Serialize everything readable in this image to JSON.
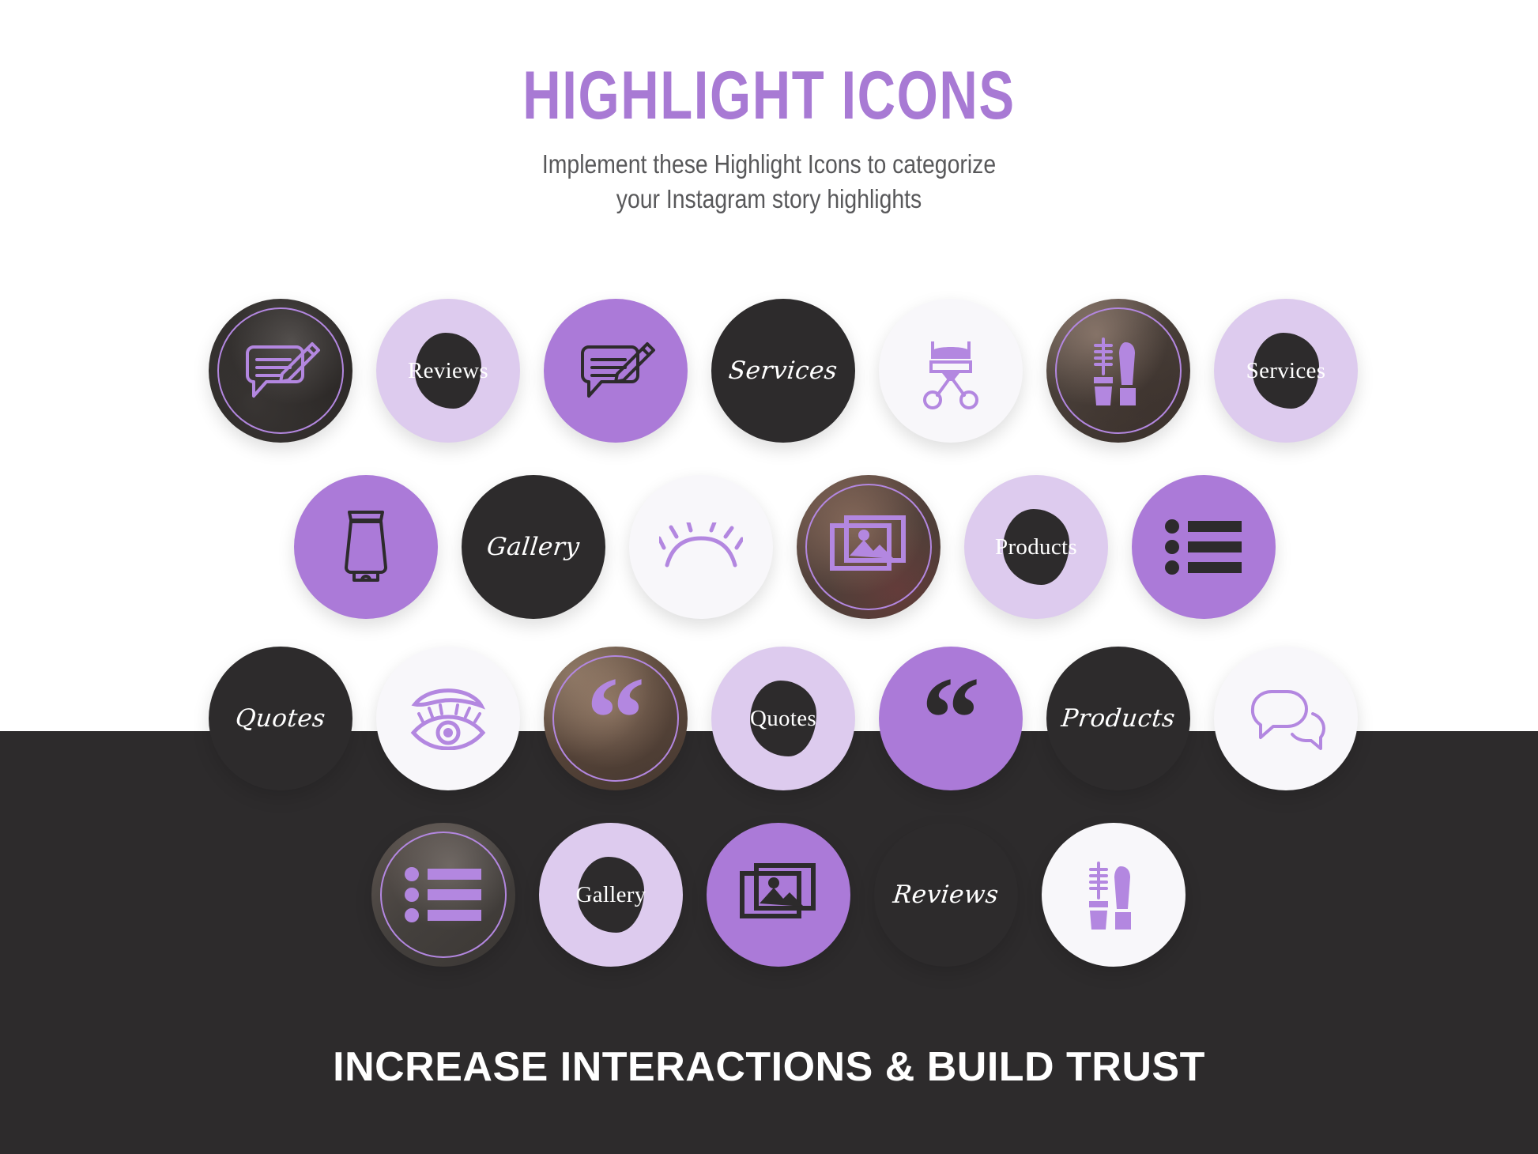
{
  "header": {
    "title": "HIGHLIGHT ICONS",
    "subtitle_line1": "Implement these Highlight Icons to categorize",
    "subtitle_line2": "your Instagram story highlights"
  },
  "footer": {
    "tagline": "INCREASE INTERACTIONS & BUILD TRUST"
  },
  "colors": {
    "accent_purple": "#ab7ad8",
    "title_purple": "#a87ad4",
    "light_lilac": "#ddcbee",
    "dark_charcoal": "#2d2b2c",
    "off_white": "#f8f7fa",
    "icon_stroke_purple": "#b387e0",
    "subtitle_grey": "#58585a",
    "background_white": "#ffffff"
  },
  "rows": [
    {
      "name": "row-1",
      "items": [
        {
          "id": "r1c1",
          "style": "photo1",
          "ring": true,
          "kind": "icon",
          "icon": "speech-bubble-pencil-icon",
          "stroke": "purple",
          "label": ""
        },
        {
          "id": "r1c2",
          "style": "lilac",
          "ring": false,
          "kind": "label",
          "icon": "text-blob",
          "stroke": "",
          "label": "Reviews"
        },
        {
          "id": "r1c3",
          "style": "purple",
          "ring": false,
          "kind": "icon",
          "icon": "speech-bubble-pencil-icon",
          "stroke": "dark",
          "label": ""
        },
        {
          "id": "r1c4",
          "style": "dark",
          "ring": false,
          "kind": "script",
          "icon": "",
          "stroke": "",
          "label": "Services"
        },
        {
          "id": "r1c5",
          "style": "white",
          "ring": false,
          "kind": "icon",
          "icon": "eyelash-curler-icon",
          "stroke": "purple",
          "label": ""
        },
        {
          "id": "r1c6",
          "style": "photo2",
          "ring": true,
          "kind": "icon",
          "icon": "mascara-icon",
          "stroke": "purple",
          "label": ""
        },
        {
          "id": "r1c7",
          "style": "lilac",
          "ring": false,
          "kind": "label",
          "icon": "text-blob",
          "stroke": "",
          "label": "Services"
        }
      ]
    },
    {
      "name": "row-2",
      "items": [
        {
          "id": "r2c1",
          "style": "purple",
          "ring": false,
          "kind": "icon",
          "icon": "cream-tube-icon",
          "stroke": "dark",
          "label": ""
        },
        {
          "id": "r2c2",
          "style": "dark",
          "ring": false,
          "kind": "script",
          "icon": "",
          "stroke": "",
          "label": "Gallery"
        },
        {
          "id": "r2c3",
          "style": "white",
          "ring": false,
          "kind": "icon",
          "icon": "eyelash-arc-icon",
          "stroke": "purple",
          "label": ""
        },
        {
          "id": "r2c4",
          "style": "photo3",
          "ring": true,
          "kind": "icon",
          "icon": "gallery-photos-icon",
          "stroke": "purple",
          "label": ""
        },
        {
          "id": "r2c5",
          "style": "lilac",
          "ring": false,
          "kind": "label",
          "icon": "text-blob",
          "stroke": "",
          "label": "Products"
        },
        {
          "id": "r2c6",
          "style": "purple",
          "ring": false,
          "kind": "icon",
          "icon": "bullet-list-icon",
          "stroke": "dark",
          "label": ""
        }
      ]
    },
    {
      "name": "row-3",
      "items": [
        {
          "id": "r3c1",
          "style": "dark",
          "ring": false,
          "kind": "script",
          "icon": "",
          "stroke": "",
          "label": "Quotes"
        },
        {
          "id": "r3c2",
          "style": "white",
          "ring": false,
          "kind": "icon",
          "icon": "eye-brow-icon",
          "stroke": "purple",
          "label": ""
        },
        {
          "id": "r3c3",
          "style": "photo4",
          "ring": true,
          "kind": "quote",
          "icon": "quote-marks-icon",
          "stroke": "purple",
          "label": "“"
        },
        {
          "id": "r3c4",
          "style": "lilac",
          "ring": false,
          "kind": "label",
          "icon": "text-blob",
          "stroke": "",
          "label": "Quotes"
        },
        {
          "id": "r3c5",
          "style": "purple",
          "ring": false,
          "kind": "quote",
          "icon": "quote-marks-icon",
          "stroke": "dark",
          "label": "“"
        },
        {
          "id": "r3c6",
          "style": "dark",
          "ring": false,
          "kind": "script",
          "icon": "",
          "stroke": "",
          "label": "Products"
        },
        {
          "id": "r3c7",
          "style": "white",
          "ring": false,
          "kind": "icon",
          "icon": "chat-bubbles-icon",
          "stroke": "purple",
          "label": ""
        }
      ]
    },
    {
      "name": "row-4",
      "items": [
        {
          "id": "r4c1",
          "style": "photo5",
          "ring": true,
          "kind": "icon",
          "icon": "bullet-list-icon",
          "stroke": "purple",
          "label": ""
        },
        {
          "id": "r4c2",
          "style": "lilac",
          "ring": false,
          "kind": "label",
          "icon": "text-blob",
          "stroke": "",
          "label": "Gallery"
        },
        {
          "id": "r4c3",
          "style": "purple",
          "ring": false,
          "kind": "icon",
          "icon": "gallery-photos-icon",
          "stroke": "dark",
          "label": ""
        },
        {
          "id": "r4c4",
          "style": "dark",
          "ring": false,
          "kind": "script",
          "icon": "",
          "stroke": "",
          "label": "Reviews"
        },
        {
          "id": "r4c5",
          "style": "white",
          "ring": false,
          "kind": "icon",
          "icon": "mascara-icon",
          "stroke": "purple",
          "label": ""
        }
      ]
    }
  ]
}
